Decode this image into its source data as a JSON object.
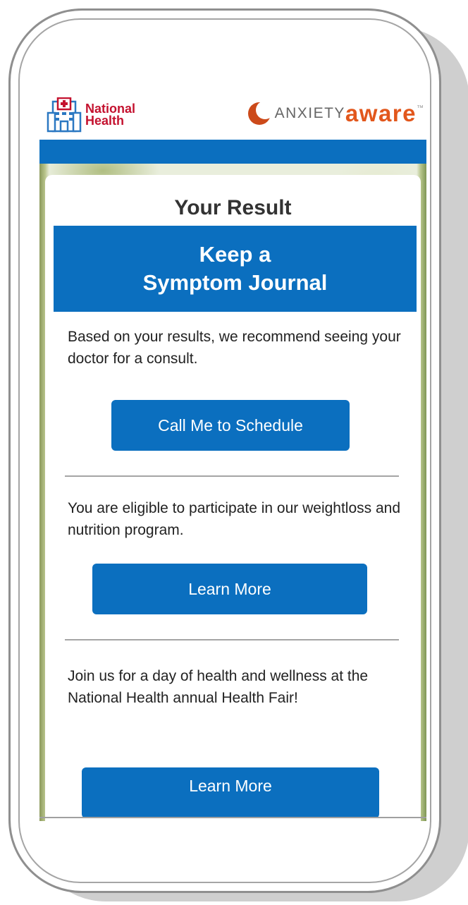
{
  "header": {
    "national_health_line1": "National",
    "national_health_line2": "Health",
    "anxiety_aware_part1": "ANXIETY",
    "anxiety_aware_part2": "aware",
    "anxiety_aware_tm": "™"
  },
  "result": {
    "title": "Your Result",
    "recommendation_line1": "Keep a",
    "recommendation_line2": "Symptom Journal"
  },
  "sections": [
    {
      "text": "Based on your results, we recommend seeing your doctor for a consult.",
      "button_label": "Call Me to Schedule"
    },
    {
      "text": "You are eligible to participate in our weightloss and nutrition program.",
      "button_label": "Learn More"
    },
    {
      "text": "Join us for a day of health and wellness at the National Health annual Health Fair!",
      "button_label": "Learn More"
    }
  ],
  "colors": {
    "primary_blue": "#0b6fbf",
    "national_health_red": "#c4122f",
    "anxiety_aware_orange": "#e2571c",
    "text_dark": "#222222"
  },
  "icons": {
    "national_health_logo": "hospital-building-icon",
    "anxiety_aware_logo": "crescent-icon"
  }
}
